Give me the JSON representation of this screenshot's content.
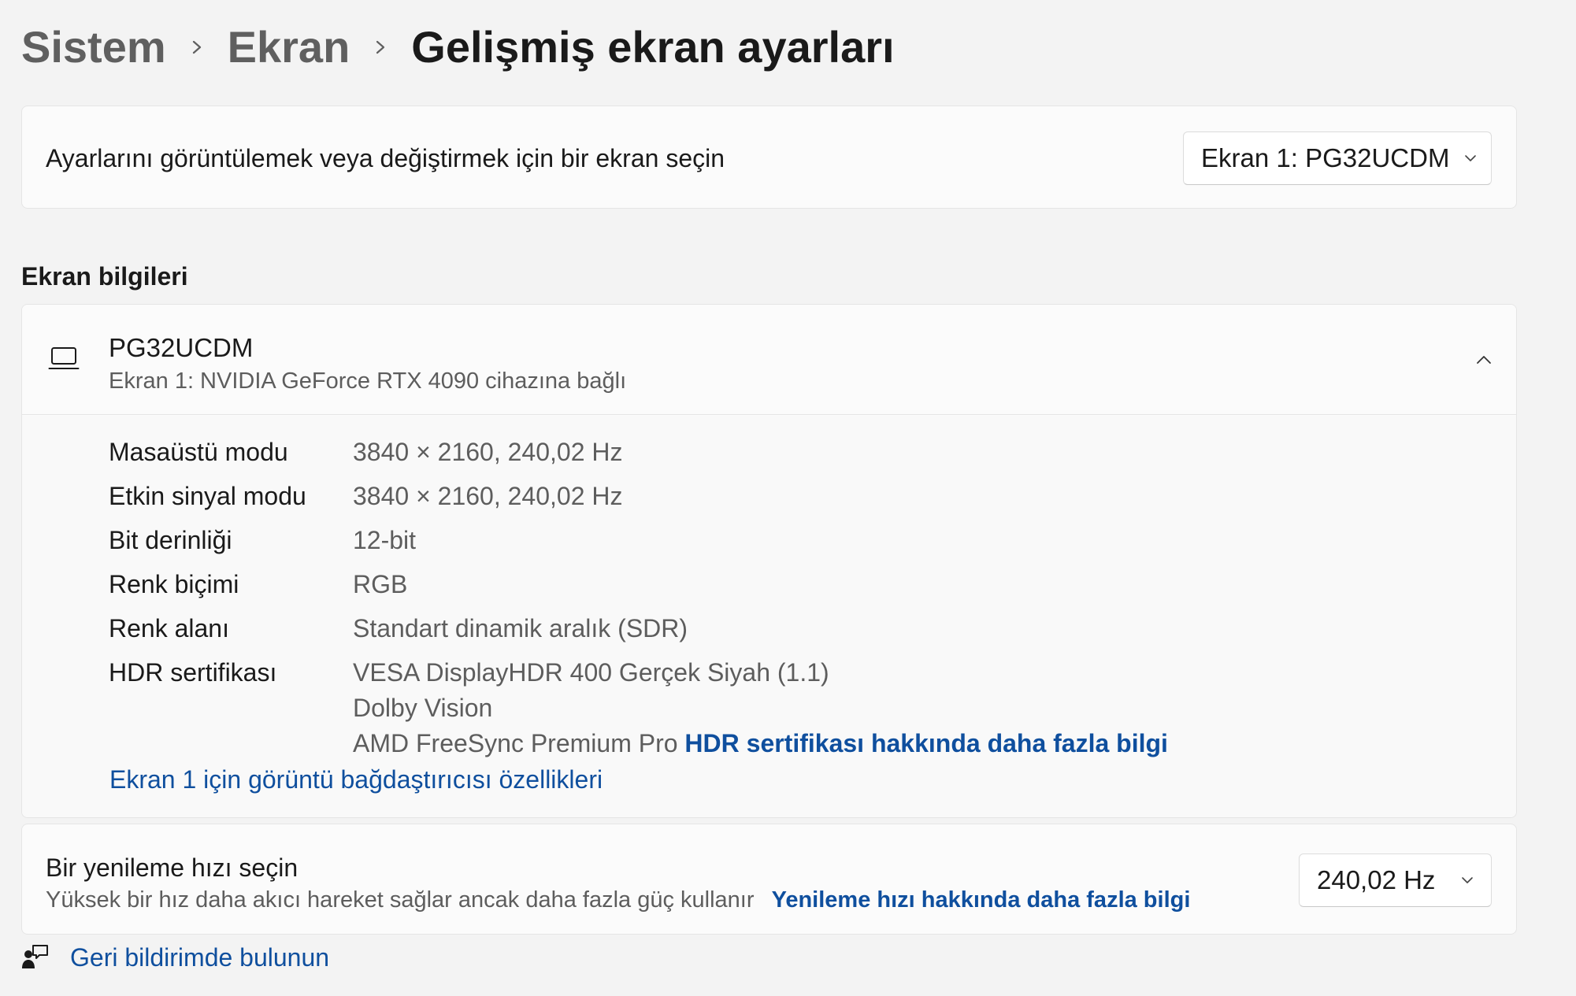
{
  "breadcrumb": {
    "items": [
      "Sistem",
      "Ekran"
    ],
    "current": "Gelişmiş ekran ayarları"
  },
  "display_select": {
    "label": "Ayarlarını görüntülemek veya değiştirmek için bir ekran seçin",
    "selected": "Ekran 1: PG32UCDM",
    "icon": "chevron-down-icon"
  },
  "display_info": {
    "section_title": "Ekran bilgileri",
    "monitor_name": "PG32UCDM",
    "monitor_subtitle": "Ekran 1: NVIDIA GeForce RTX 4090 cihazına bağlı",
    "device_icon": "laptop-icon",
    "expanded": true,
    "properties": [
      {
        "label": "Masaüstü modu",
        "value": "3840 × 2160, 240,02 Hz"
      },
      {
        "label": "Etkin sinyal modu",
        "value": "3840 × 2160, 240,02 Hz"
      },
      {
        "label": "Bit derinliği",
        "value": "12-bit"
      },
      {
        "label": "Renk biçimi",
        "value": "RGB"
      },
      {
        "label": "Renk alanı",
        "value": "Standart dinamik aralık (SDR)"
      }
    ],
    "hdr": {
      "label": "HDR sertifikası",
      "values": [
        "VESA DisplayHDR 400 Gerçek Siyah (1.1)",
        "Dolby Vision",
        "AMD FreeSync Premium Pro"
      ],
      "link": "HDR sertifikası hakkında daha fazla bilgi"
    },
    "adapter_link": "Ekran 1 için görüntü bağdaştırıcısı özellikleri"
  },
  "refresh": {
    "title": "Bir yenileme hızı seçin",
    "subtitle": "Yüksek bir hız daha akıcı hareket sağlar ancak daha fazla güç kullanır",
    "link": "Yenileme hızı hakkında daha fazla bilgi",
    "selected": "240,02 Hz"
  },
  "feedback": {
    "text": "Geri bildirimde bulunun",
    "icon": "feedback-icon"
  },
  "colors": {
    "background": "#f3f3f3",
    "card": "#fbfbfb",
    "link": "#0f4f9e",
    "secondary_text": "#5d5d5d"
  }
}
